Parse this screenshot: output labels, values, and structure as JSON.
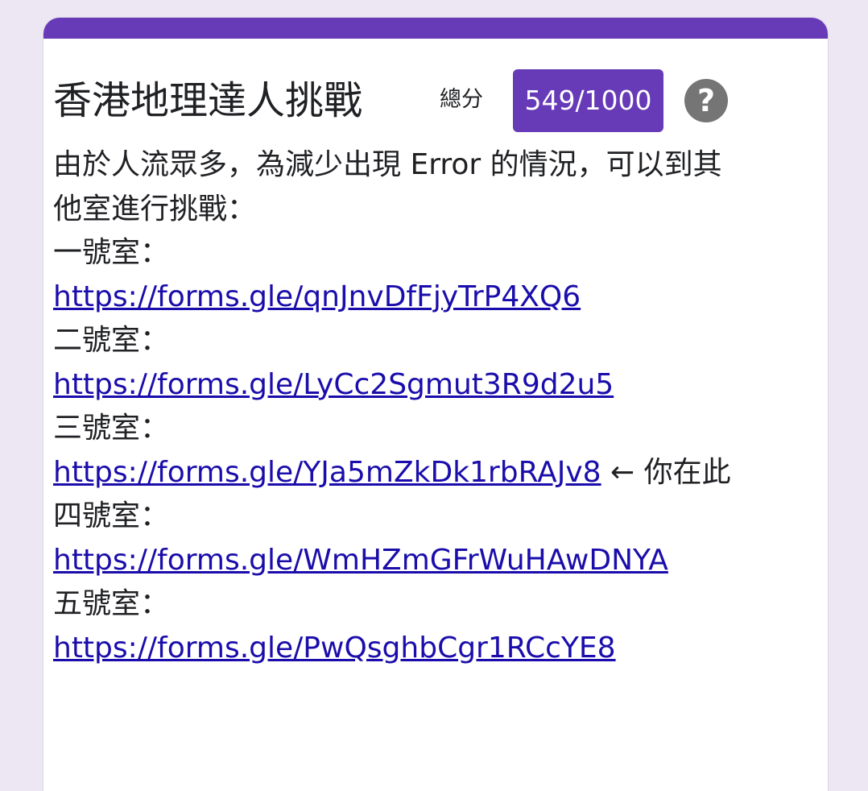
{
  "form": {
    "title": "香港地理達人挑戰",
    "score_label": "總分",
    "score": "549/1000",
    "help_icon": "help-circle-icon",
    "accent_color": "#673ab7"
  },
  "description": {
    "intro": "由於人流眾多，為減少出現 Error 的情況，可以到其他室進行挑戰：",
    "rooms": [
      {
        "label": "一號室：",
        "url": "https://forms.gle/qnJnvDfFjyTrP4XQ6",
        "note": ""
      },
      {
        "label": "二號室：",
        "url": "https://forms.gle/LyCc2Sgmut3R9d2u5",
        "note": ""
      },
      {
        "label": "三號室：",
        "url": "https://forms.gle/YJa5mZkDk1rbRAJv8",
        "note": " ← 你在此"
      },
      {
        "label": "四號室：",
        "url": "https://forms.gle/WmHZmGFrWuHAwDNYA",
        "note": ""
      },
      {
        "label": "五號室：",
        "url": "https://forms.gle/PwQsghbCgr1RCcYE8",
        "note": ""
      }
    ]
  }
}
